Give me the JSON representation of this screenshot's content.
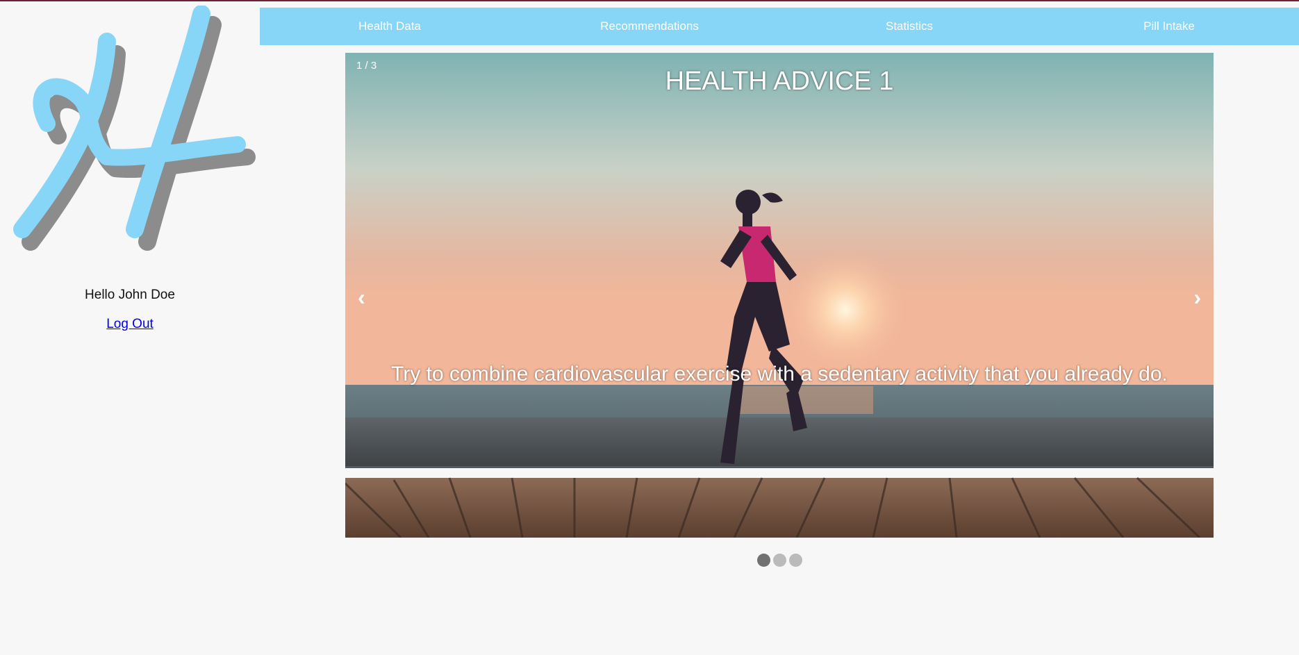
{
  "user": {
    "greeting": "Hello John Doe",
    "logout_label": "Log Out"
  },
  "logo": {
    "letter": "H",
    "color": "#87d6f7",
    "shadow_color": "#8c8c8c"
  },
  "nav": {
    "items": [
      {
        "label": "Health Data"
      },
      {
        "label": "Recommendations"
      },
      {
        "label": "Statistics"
      },
      {
        "label": "Pill Intake"
      }
    ],
    "background": "#87d6f7"
  },
  "slideshow": {
    "counter": "1 / 3",
    "title": "HEALTH ADVICE 1",
    "caption": "Try to combine cardiovascular exercise with a sedentary activity that you already do.",
    "prev_icon": "‹",
    "next_icon": "›",
    "total": 3,
    "active_index": 0
  }
}
